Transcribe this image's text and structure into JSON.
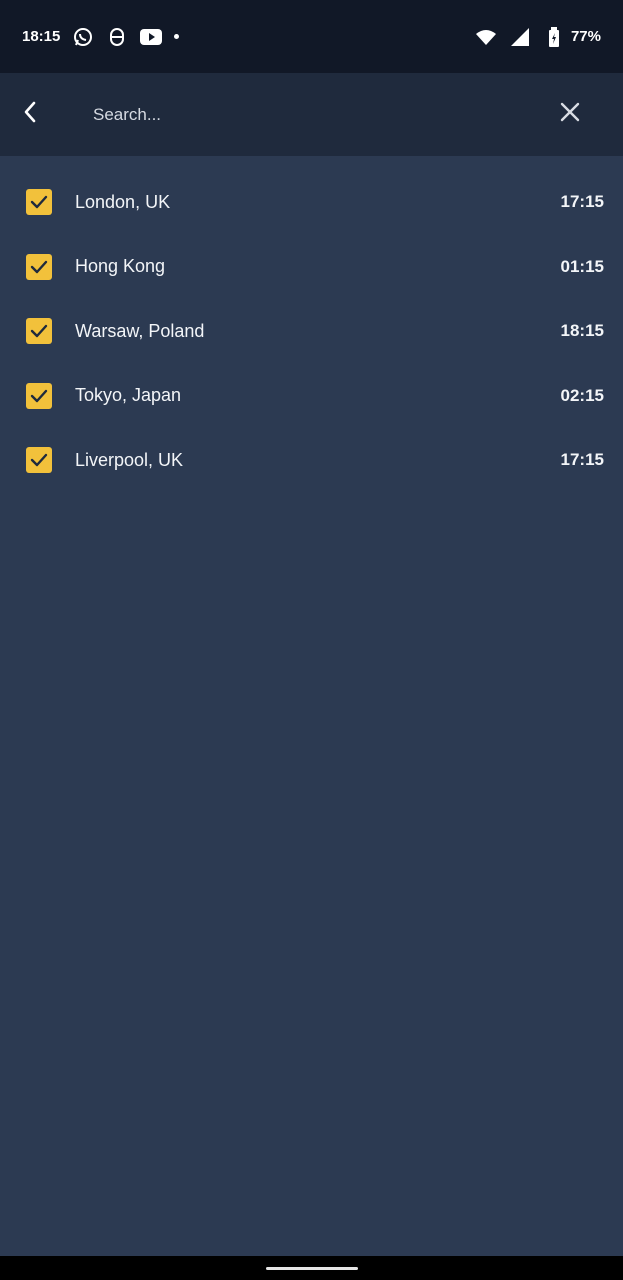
{
  "status_bar": {
    "time": "18:15",
    "battery": "77%",
    "icons": [
      "whatsapp-icon",
      "app-icon",
      "youtube-icon",
      "notification-dot",
      "wifi-icon",
      "signal-icon",
      "battery-icon"
    ]
  },
  "toolbar": {
    "search_placeholder": "Search...",
    "back_icon": "chevron-left-icon",
    "clear_icon": "close-icon"
  },
  "cities": [
    {
      "name": "London, UK",
      "time": "17:15",
      "checked": true
    },
    {
      "name": "Hong Kong",
      "time": "01:15",
      "checked": true
    },
    {
      "name": "Warsaw, Poland",
      "time": "18:15",
      "checked": true
    },
    {
      "name": "Tokyo, Japan",
      "time": "02:15",
      "checked": true
    },
    {
      "name": "Liverpool, UK",
      "time": "17:15",
      "checked": true
    }
  ],
  "colors": {
    "background": "#2c3a52",
    "toolbar": "#1f2a3d",
    "status_bar": "#111827",
    "checkbox": "#f2c13b"
  }
}
